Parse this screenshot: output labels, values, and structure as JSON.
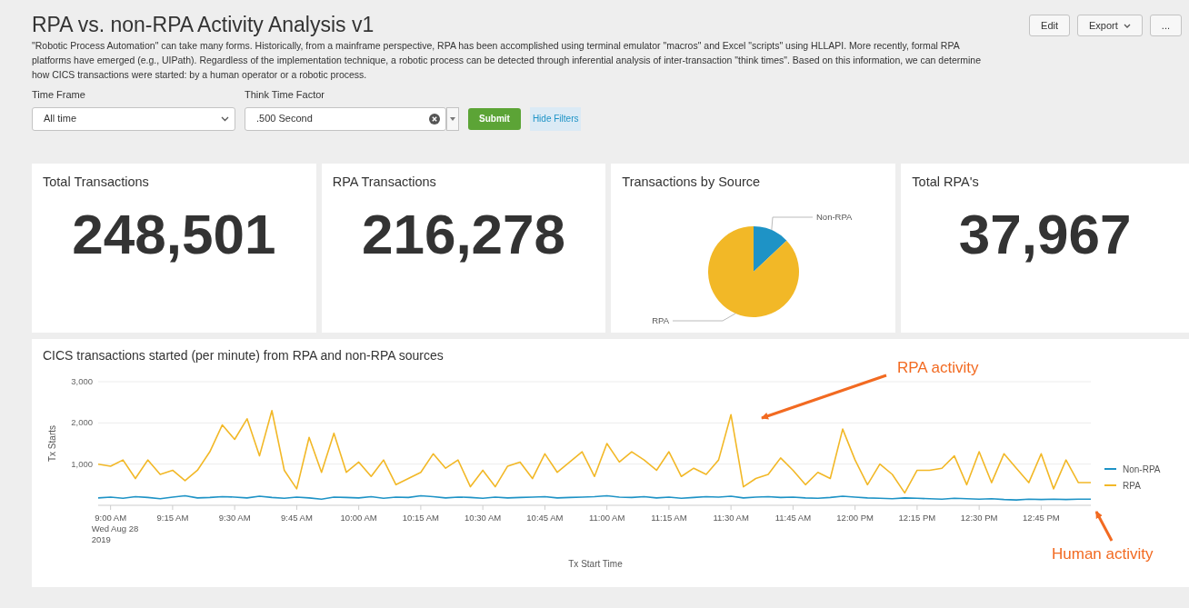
{
  "title": "RPA vs. non-RPA Activity Analysis v1",
  "header_buttons": [
    {
      "label": "Edit",
      "kind": "plain"
    },
    {
      "label": "Export",
      "kind": "dropdown"
    },
    {
      "label": "...",
      "kind": "plain"
    }
  ],
  "description": "\"Robotic Process Automation\" can take many forms. Historically, from a mainframe perspective, RPA has been accomplished using terminal emulator \"macros\" and Excel \"scripts\" using HLLAPI. More recently, formal RPA platforms have emerged (e.g., UIPath). Regardless of the implementation technique, a robotic process can be detected through inferential analysis of inter-transaction \"think times\". Based on this information, we can determine how CICS transactions were started: by a human operator or a robotic process.",
  "filters": [
    {
      "label": "Time Frame",
      "value": "All time",
      "kind": "select"
    },
    {
      "label": "Think Time Factor",
      "value": ".500 Second",
      "kind": "combo"
    }
  ],
  "submit_label": "Submit",
  "hide_filters_label": "Hide Filters",
  "panels": [
    {
      "kind": "single",
      "title": "Total Transactions",
      "value": "248,501"
    },
    {
      "kind": "single",
      "title": "RPA Transactions",
      "value": "216,278"
    },
    {
      "kind": "pie",
      "title": "Transactions by Source",
      "chart_data": {
        "type": "pie",
        "categories": [
          "Non-RPA",
          "RPA"
        ],
        "values": [
          12.97,
          87.03
        ],
        "colors": [
          "#1e93c6",
          "#f2b827"
        ]
      }
    },
    {
      "kind": "single",
      "title": "Total RPA's",
      "value": "37,967"
    }
  ],
  "timechart": {
    "title": "CICS transactions started (per minute) from RPA and non-RPA sources",
    "date_caption": [
      "Wed Aug 28",
      "2019"
    ],
    "callouts": [
      {
        "text": "RPA activity"
      },
      {
        "text": "Human activity"
      }
    ],
    "chart_data": {
      "type": "line",
      "xlabel": "Tx Start Time",
      "ylabel": "Tx Starts",
      "ylim": [
        0,
        3000
      ],
      "yticks": [
        {
          "value": 1000,
          "label": "1,000"
        },
        {
          "value": 2000,
          "label": "2,000"
        },
        {
          "value": 3000,
          "label": "3,000"
        }
      ],
      "categories": [
        null,
        "9:00 AM",
        null,
        null,
        null,
        null,
        "9:15 AM",
        null,
        null,
        null,
        null,
        "9:30 AM",
        null,
        null,
        null,
        null,
        "9:45 AM",
        null,
        null,
        null,
        null,
        "10:00 AM",
        null,
        null,
        null,
        null,
        "10:15 AM",
        null,
        null,
        null,
        null,
        "10:30 AM",
        null,
        null,
        null,
        null,
        "10:45 AM",
        null,
        null,
        null,
        null,
        "11:00 AM",
        null,
        null,
        null,
        null,
        "11:15 AM",
        null,
        null,
        null,
        null,
        "11:30 AM",
        null,
        null,
        null,
        null,
        "11:45 AM",
        null,
        null,
        null,
        null,
        "12:00 PM",
        null,
        null,
        null,
        null,
        "12:15 PM",
        null,
        null,
        null,
        null,
        "12:30 PM",
        null,
        null,
        null,
        null,
        "12:45 PM",
        null,
        null,
        null,
        null
      ],
      "series": [
        {
          "name": "Non-RPA",
          "color": "#1e93c6",
          "values": [
            180,
            200,
            170,
            210,
            190,
            160,
            200,
            230,
            180,
            190,
            210,
            200,
            180,
            220,
            190,
            170,
            200,
            180,
            150,
            200,
            190,
            180,
            210,
            170,
            200,
            190,
            230,
            210,
            180,
            200,
            190,
            170,
            200,
            180,
            190,
            200,
            210,
            180,
            190,
            200,
            210,
            230,
            200,
            190,
            210,
            180,
            200,
            170,
            190,
            210,
            200,
            220,
            180,
            200,
            210,
            190,
            200,
            180,
            170,
            190,
            220,
            200,
            180,
            170,
            160,
            180,
            170,
            160,
            150,
            170,
            160,
            150,
            160,
            140,
            130,
            150,
            140,
            150,
            140,
            150,
            150
          ]
        },
        {
          "name": "RPA",
          "color": "#f2b827",
          "values": [
            1000,
            950,
            1100,
            650,
            1100,
            750,
            850,
            600,
            850,
            1300,
            1950,
            1600,
            2100,
            1200,
            2300,
            850,
            400,
            1650,
            800,
            1750,
            800,
            1050,
            700,
            1100,
            500,
            650,
            800,
            1250,
            900,
            1100,
            450,
            850,
            450,
            950,
            1050,
            650,
            1250,
            800,
            1050,
            1300,
            700,
            1500,
            1050,
            1300,
            1100,
            850,
            1300,
            700,
            900,
            750,
            1100,
            2200,
            450,
            650,
            750,
            1150,
            850,
            500,
            800,
            650,
            1850,
            1100,
            500,
            1000,
            750,
            300,
            850,
            850,
            900,
            1200,
            500,
            1300,
            550,
            1250,
            900,
            550,
            1250,
            400,
            1100,
            550,
            550
          ]
        }
      ],
      "legend": true
    }
  }
}
